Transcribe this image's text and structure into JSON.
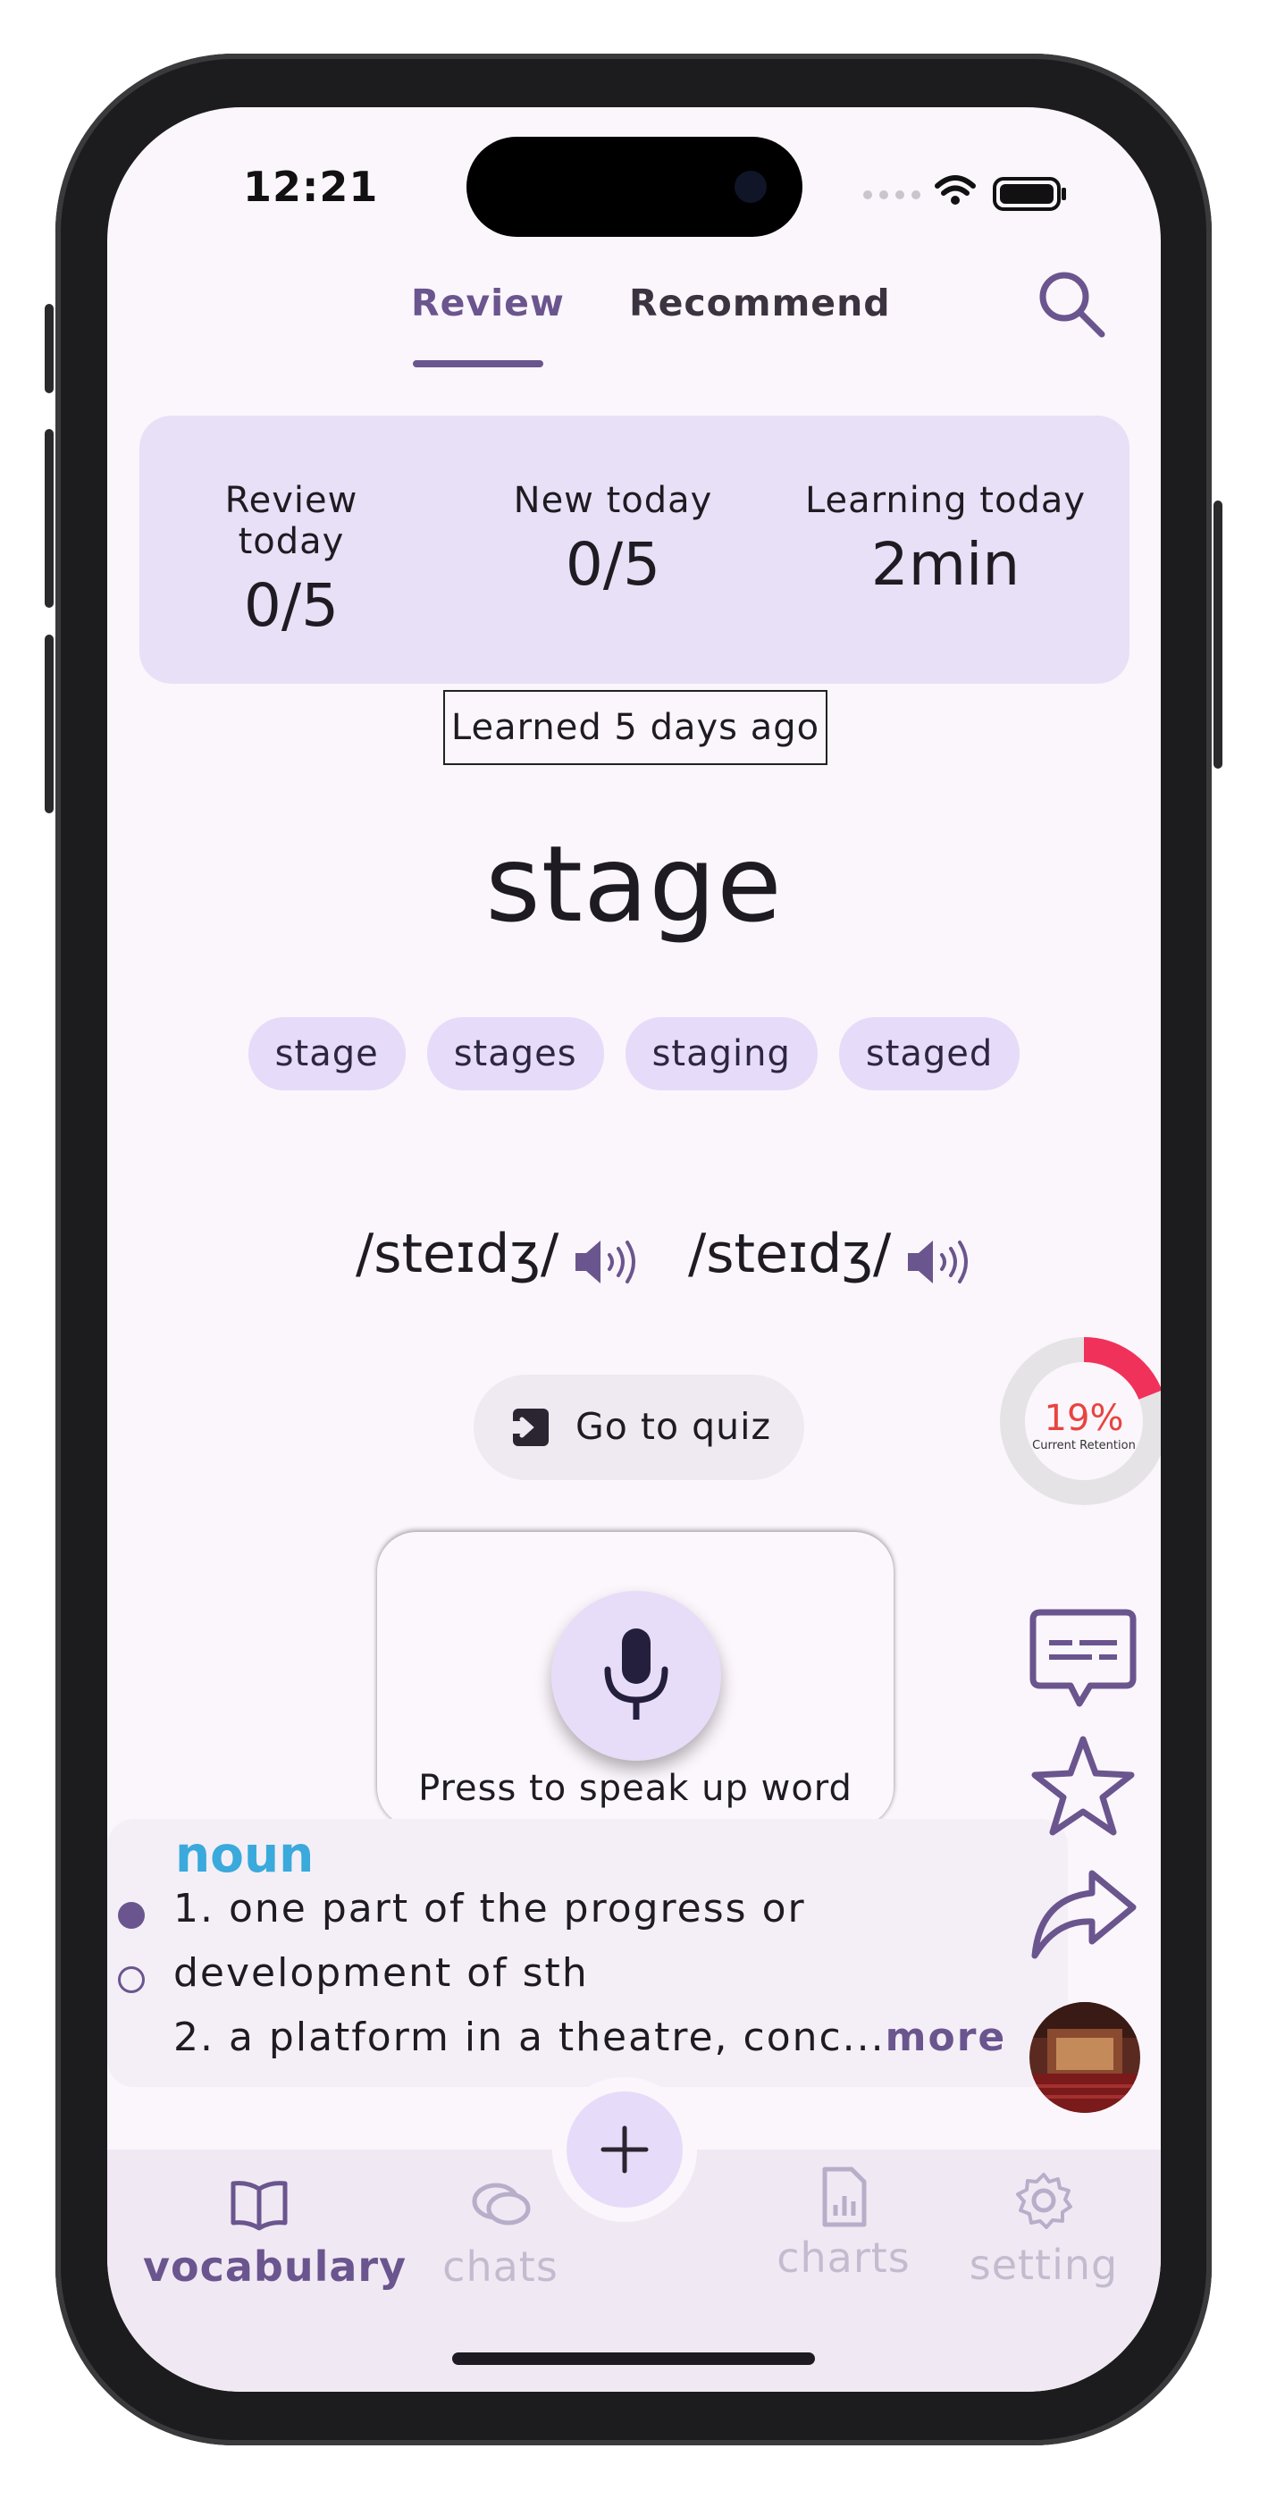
{
  "status_bar": {
    "time": "12:21"
  },
  "tabs": [
    {
      "label": "Review"
    },
    {
      "label": "Recommend"
    }
  ],
  "stats": [
    {
      "label": "Review today",
      "value": "0/5"
    },
    {
      "label": "New today",
      "value": "0/5"
    },
    {
      "label": "Learning today",
      "value": "2min"
    }
  ],
  "learned_label": "Learned 5 days ago",
  "word": "stage",
  "forms": [
    "stage",
    "stages",
    "staging",
    "staged"
  ],
  "phonetics": {
    "uk": "/steɪdʒ/",
    "us": "/steɪdʒ/"
  },
  "quiz_button": "Go to quiz",
  "retention": {
    "percent_label": "19%",
    "caption": "Current Retention",
    "fraction": 0.19,
    "color": "#f0325a"
  },
  "speak": {
    "label": "Press to speak up word"
  },
  "definition": {
    "part_of_speech": "noun",
    "line1": "1. one part of the progress or",
    "line2": "development of sth",
    "line3": "2. a platform in a theatre, conc...",
    "more": "more"
  },
  "nav": [
    {
      "label": "vocabulary",
      "icon": "book-icon",
      "active": true
    },
    {
      "label": "chats",
      "icon": "chat-bubbles-icon",
      "active": false
    },
    {
      "label": "charts",
      "icon": "chart-file-icon",
      "active": false
    },
    {
      "label": "setting",
      "icon": "gear-icon",
      "active": false
    }
  ],
  "colors": {
    "accent": "#6a558e",
    "noun": "#3aa9dc",
    "chip": "#e6dcf9",
    "card": "#e8e0f6"
  }
}
